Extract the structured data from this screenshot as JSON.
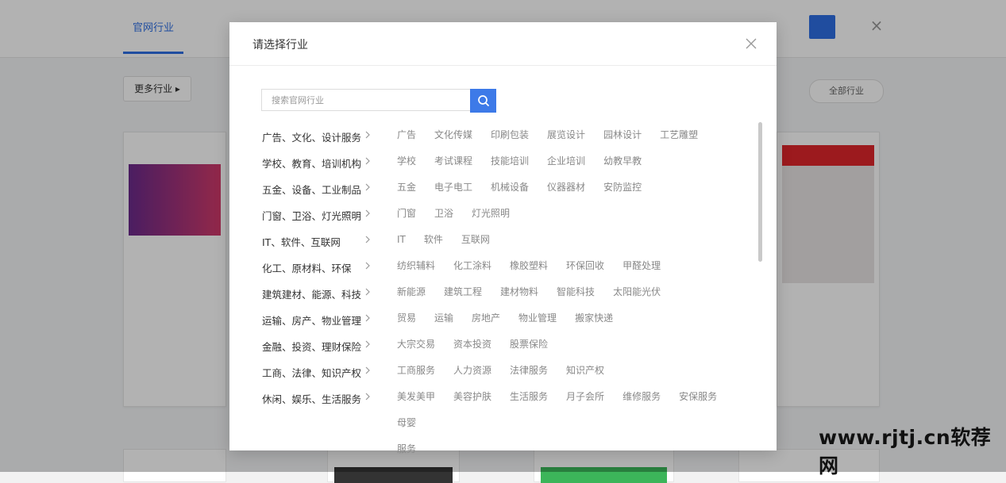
{
  "background": {
    "tab_label": "官网行业",
    "filter_label": "更多行业 ▸",
    "filter_right_label": "全部行业"
  },
  "modal": {
    "title": "请选择行业",
    "search_placeholder": "搜索官网行业",
    "close_icon": "close-icon",
    "search_icon": "search-icon",
    "categories": [
      {
        "name": "广告、文化、设计服务",
        "subs": [
          "广告",
          "文化传媒",
          "印刷包装",
          "展览设计",
          "园林设计",
          "工艺雕塑"
        ]
      },
      {
        "name": "学校、教育、培训机构",
        "subs": [
          "学校",
          "考试课程",
          "技能培训",
          "企业培训",
          "幼教早教"
        ]
      },
      {
        "name": "五金、设备、工业制品",
        "subs": [
          "五金",
          "电子电工",
          "机械设备",
          "仪器器材",
          "安防监控"
        ]
      },
      {
        "name": "门窗、卫浴、灯光照明",
        "subs": [
          "门窗",
          "卫浴",
          "灯光照明"
        ]
      },
      {
        "name": "IT、软件、互联网",
        "subs": [
          "IT",
          "软件",
          "互联网"
        ]
      },
      {
        "name": "化工、原材料、环保",
        "subs": [
          "纺织辅料",
          "化工涂料",
          "橡胶塑料",
          "环保回收",
          "甲醛处理"
        ]
      },
      {
        "name": "建筑建材、能源、科技",
        "subs": [
          "新能源",
          "建筑工程",
          "建材物料",
          "智能科技",
          "太阳能光伏"
        ]
      },
      {
        "name": "运输、房产、物业管理",
        "subs": [
          "贸易",
          "运输",
          "房地产",
          "物业管理",
          "搬家快递"
        ]
      },
      {
        "name": "金融、投资、理财保险",
        "subs": [
          "大宗交易",
          "资本投资",
          "股票保险"
        ]
      },
      {
        "name": "工商、法律、知识产权",
        "subs": [
          "工商服务",
          "人力资源",
          "法律服务",
          "知识产权"
        ]
      },
      {
        "name": "休闲、娱乐、生活服务",
        "subs": [
          "美发美甲",
          "美容护肤",
          "生活服务",
          "月子会所",
          "维修服务",
          "安保服务",
          "母婴"
        ],
        "tail": "服务"
      }
    ]
  },
  "watermark": "www.rjtj.cn软荐网",
  "colors": {
    "accent": "#3d7ae8",
    "overlay": "rgba(0,0,0,0.30)"
  }
}
